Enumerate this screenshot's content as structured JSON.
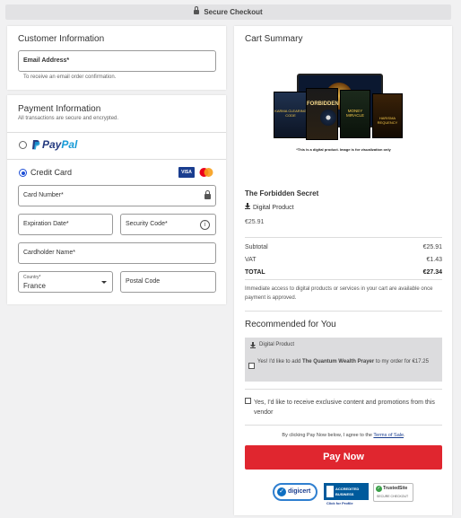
{
  "header": {
    "secure_label": "Secure Checkout"
  },
  "customer": {
    "title": "Customer Information",
    "email_label": "Email Address*",
    "email_hint": "To receive an email order confirmation."
  },
  "payment": {
    "title": "Payment Information",
    "subtitle": "All transactions are secure and encrypted.",
    "paypal_label": "PayPal",
    "paypal_prefix": "Pay",
    "paypal_suffix": "Pal",
    "credit_label": "Credit Card",
    "visa_label": "VISA",
    "card_number_label": "Card Number*",
    "expiration_label": "Expiration Date*",
    "security_label": "Security Code*",
    "cardholder_label": "Cardholder Name*",
    "country_label": "Country*",
    "country_value": "France",
    "postal_label": "Postal Code"
  },
  "cart": {
    "title": "Cart Summary",
    "image_caption": "*This is a digital product. Image is for visualization only",
    "product_name": "The Forbidden Secret",
    "product_type": "Digital Product",
    "product_price": "€25.91",
    "subtotal_label": "Subtotal",
    "subtotal_value": "€25.91",
    "vat_label": "VAT",
    "vat_value": "€1.43",
    "total_label": "TOTAL",
    "total_value": "€27.34",
    "access_note": "Immediate access to digital products or services in your cart are available once payment is approved.",
    "book_titles": [
      "KARMA CLEARING CODE",
      "FORBIDDEN",
      "MONEY MIRACLE",
      "HARISMA REQUENCY"
    ]
  },
  "recommended": {
    "title": "Recommended for You",
    "product_type": "Digital Product",
    "offer_prefix": "Yes! I'd like to add ",
    "offer_product": "The Quantum Wealth Prayer",
    "offer_suffix": " to my order for €17.25"
  },
  "promo": {
    "label": "Yes, I'd like to receive exclusive content and promotions from this vendor"
  },
  "terms": {
    "prefix": "By clicking Pay Now below, I agree to the ",
    "link": "Terms of Sale",
    "suffix": "."
  },
  "pay_button": "Pay Now",
  "badges": {
    "digicert": "digicert",
    "bbb_line1": "ACCREDITED",
    "bbb_line2": "BUSINESS",
    "bbb_click": "Click for Profile",
    "trusted_name": "TrustedSite",
    "trusted_sub": "SECURE CHECKOUT"
  },
  "colors": {
    "accent_blue": "#1e4fd6",
    "pay_red": "#e0262f",
    "paypal_dark": "#253b80",
    "paypal_light": "#179bd7"
  }
}
